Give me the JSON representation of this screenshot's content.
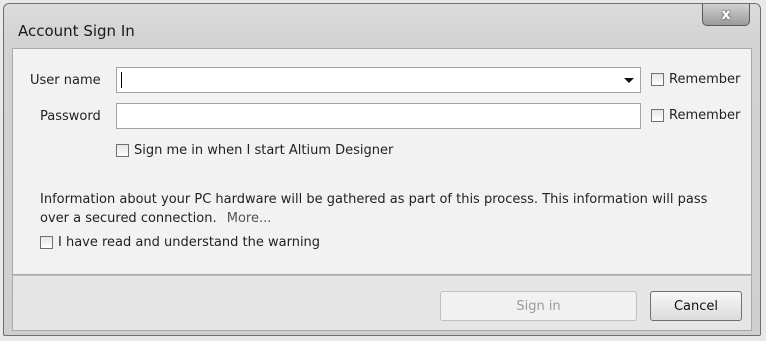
{
  "window": {
    "title": "Account Sign In",
    "close_glyph": "x"
  },
  "form": {
    "username": {
      "label": "User name",
      "value": "",
      "remember_label": "Remember",
      "remember_checked": false
    },
    "password": {
      "label": "Password",
      "value": "",
      "remember_label": "Remember",
      "remember_checked": false
    },
    "auto_sign_in": {
      "label": "Sign me in when I start Altium Designer",
      "checked": false
    }
  },
  "notice": {
    "text": "Information about your PC hardware will be gathered as part of this process. This information will pass over a secured connection.",
    "more_link": "More..."
  },
  "warning_ack": {
    "label": "I have read and understand the warning",
    "checked": false
  },
  "buttons": {
    "sign_in": "Sign in",
    "cancel": "Cancel"
  }
}
